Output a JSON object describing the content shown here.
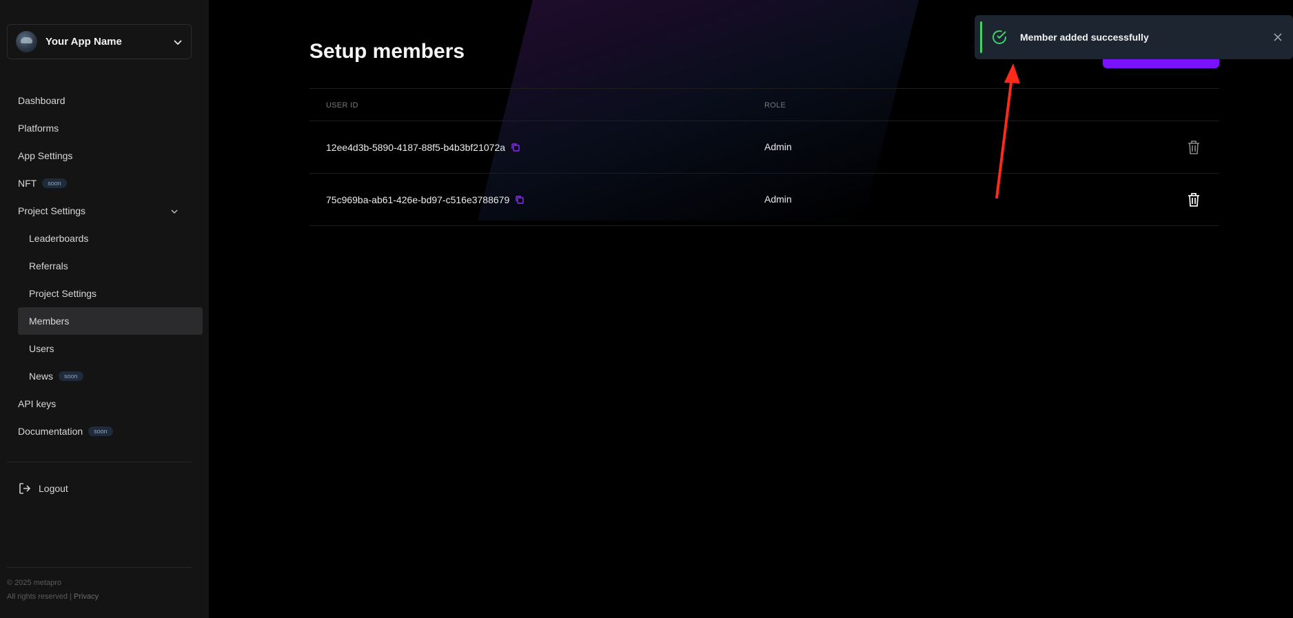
{
  "app": {
    "name": "Your App Name"
  },
  "sidebar": {
    "items": [
      {
        "label": "Dashboard"
      },
      {
        "label": "Platforms"
      },
      {
        "label": "App Settings"
      },
      {
        "label": "NFT",
        "badge": "soon"
      },
      {
        "label": "Project Settings"
      },
      {
        "label": "Leaderboards"
      },
      {
        "label": "Referrals"
      },
      {
        "label": "Project Settings"
      },
      {
        "label": "Members"
      },
      {
        "label": "Users"
      },
      {
        "label": "News",
        "badge": "soon"
      },
      {
        "label": "API keys"
      },
      {
        "label": "Documentation",
        "badge": "soon"
      }
    ],
    "logout": "Logout",
    "footer": {
      "copyright": "© 2025 metapro",
      "rights": "All rights reserved | ",
      "privacy": "Privacy"
    }
  },
  "main": {
    "title": "Setup members",
    "table": {
      "headers": {
        "user_id": "USER ID",
        "role": "ROLE"
      },
      "rows": [
        {
          "user_id": "12ee4d3b-5890-4187-88f5-b4b3bf21072a",
          "role": "Admin"
        },
        {
          "user_id": "75c969ba-ab61-426e-bd97-c516e3788679",
          "role": "Admin"
        }
      ]
    }
  },
  "toast": {
    "message": "Member added successfully"
  },
  "colors": {
    "accent": "#7a12ff",
    "success": "#3fd16b",
    "sidebar_bg": "#141414"
  }
}
